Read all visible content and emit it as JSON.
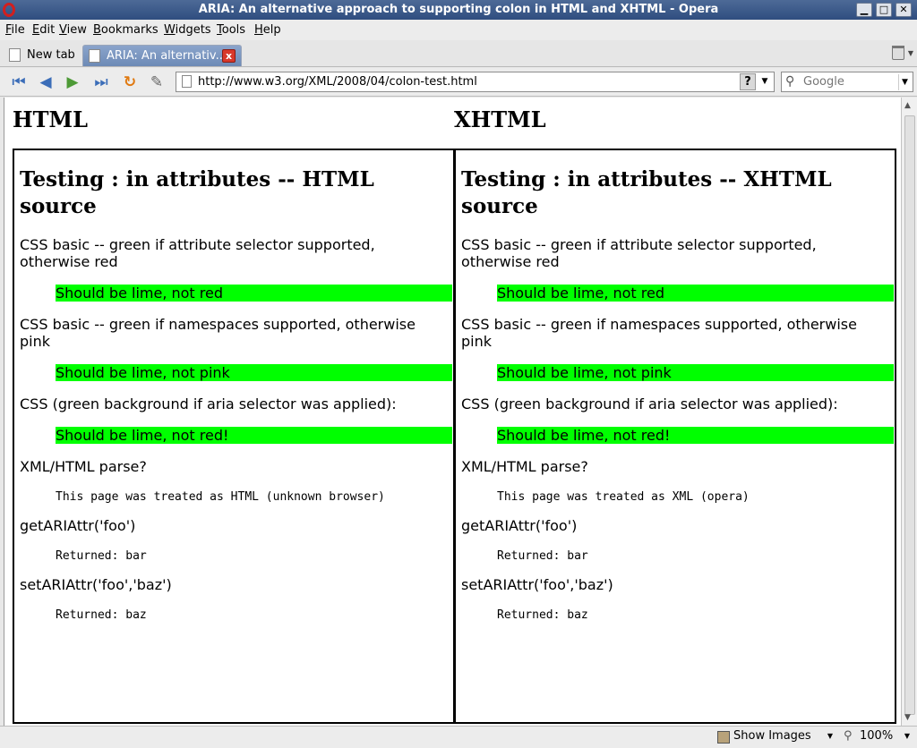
{
  "window": {
    "title": "ARIA: An alternative approach to supporting colon in HTML and XHTML - Opera",
    "minimize": "▁",
    "maximize": "□",
    "close": "✕"
  },
  "menu": [
    "File",
    "Edit",
    "View",
    "Bookmarks",
    "Widgets",
    "Tools",
    "Help"
  ],
  "tabs": {
    "new_tab": "New tab",
    "active": "ARIA: An alternativ...",
    "close": "x"
  },
  "nav": {
    "url": "http://www.w3.org/XML/2008/04/colon-test.html",
    "help_label": "?",
    "search_placeholder": "Google"
  },
  "page": {
    "columns": [
      {
        "heading": "HTML",
        "title": "Testing : in attributes -- HTML source",
        "css_attr": "CSS basic -- green if attribute selector supported, otherwise red",
        "css_attr_result": "Should be lime, not red",
        "css_ns": "CSS basic -- green if namespaces supported, otherwise pink",
        "css_ns_result": "Should be lime, not pink",
        "css_aria": "CSS (green background if aria selector was applied):",
        "css_aria_result": "Should be lime, not red!",
        "parse_label": "XML/HTML parse?",
        "parse_result": "This page was treated as HTML (unknown browser)",
        "get_label": "getARIAttr('foo')",
        "get_result": "Returned: bar",
        "set_label": "setARIAttr('foo','baz')",
        "set_result": "Returned: baz"
      },
      {
        "heading": "XHTML",
        "title": "Testing : in attributes -- XHTML source",
        "css_attr": "CSS basic -- green if attribute selector supported, otherwise red",
        "css_attr_result": "Should be lime, not red",
        "css_ns": "CSS basic -- green if namespaces supported, otherwise pink",
        "css_ns_result": "Should be lime, not pink",
        "css_aria": "CSS (green background if aria selector was applied):",
        "css_aria_result": "Should be lime, not red!",
        "parse_label": "XML/HTML parse?",
        "parse_result": "This page was treated as XML (opera)",
        "get_label": "getARIAttr('foo')",
        "get_result": "Returned: bar",
        "set_label": "setARIAttr('foo','baz')",
        "set_result": "Returned: baz"
      }
    ],
    "lime_color": "#00ff00"
  },
  "status": {
    "show_images": "Show Images",
    "zoom": "100%"
  }
}
